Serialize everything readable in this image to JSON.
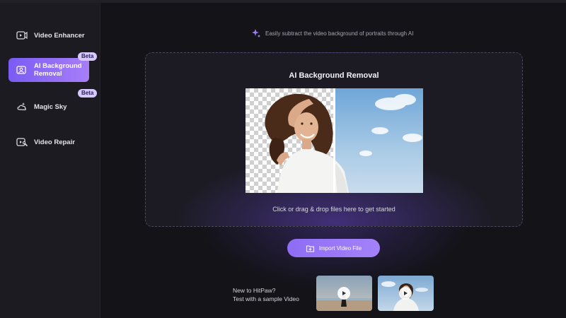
{
  "sidebar": {
    "items": [
      {
        "label": "Video Enhancer",
        "icon": "video-enhancer-icon"
      },
      {
        "label": "AI Background Removal",
        "icon": "ai-background-removal-icon",
        "badge": "Beta",
        "active": true
      },
      {
        "label": "Magic Sky",
        "icon": "magic-sky-icon",
        "badge": "Beta"
      },
      {
        "label": "Video Repair",
        "icon": "video-repair-icon"
      }
    ]
  },
  "main": {
    "tip": "Easily subtract the video background of portraits through AI",
    "dropzone": {
      "title": "AI Background Removal",
      "hint": "Click or drag & drop files here to get started"
    },
    "import_label": "Import Video File",
    "sample": {
      "line1": "New to HitPaw?",
      "line2": "Test with a sample Video"
    }
  },
  "colors": {
    "accent": "#8f6df4",
    "accent_light": "#a87ef8",
    "background": "#131318",
    "sidebar": "#1b1b21",
    "badge": "#d6c9ff"
  }
}
